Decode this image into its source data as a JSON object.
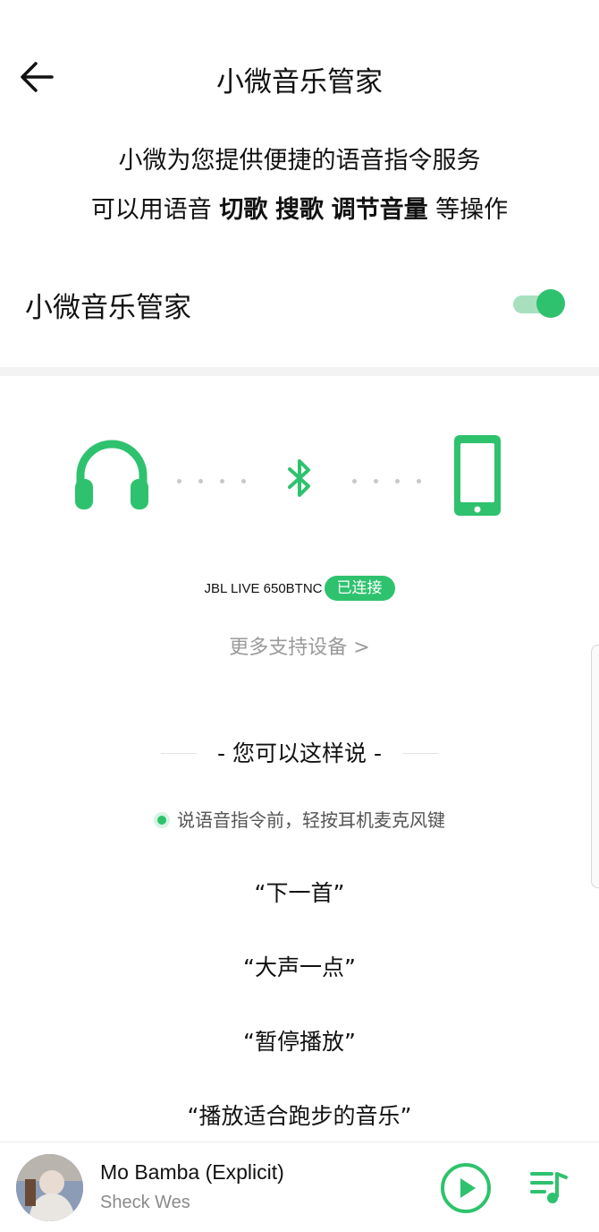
{
  "header": {
    "back_icon": "arrow-left-icon",
    "title": "小微音乐管家"
  },
  "intro": {
    "line1": "小微为您提供便捷的语音指令服务",
    "line2_prefix": "可以用语音 ",
    "keyword1": "切歌",
    "keyword2": "搜歌",
    "keyword3": "调节音量",
    "line2_suffix": " 等操作"
  },
  "toggle": {
    "label": "小微音乐管家",
    "state": "on"
  },
  "devices": {
    "left_icon": "headphones-icon",
    "middle_icon": "bluetooth-icon",
    "right_icon": "phone-icon",
    "device_name": "JBL LIVE 650BTNC",
    "status_badge": "已连接",
    "more_link": "更多支持设备 >"
  },
  "examples": {
    "heading": "- 您可以这样说 -",
    "tip": "说语音指令前，轻按耳机麦克风键",
    "commands": [
      "“下一首”",
      "“大声一点”",
      "“暂停播放”",
      "“播放适合跑步的音乐”"
    ]
  },
  "player": {
    "song_title": "Mo Bamba (Explicit)",
    "artist": "Sheck Wes",
    "play_icon": "play-circle-icon",
    "playlist_icon": "playlist-icon"
  },
  "colors": {
    "accent": "#2ec26e",
    "accent_light": "#a8e0bf",
    "muted_text": "#9a9a9a"
  }
}
